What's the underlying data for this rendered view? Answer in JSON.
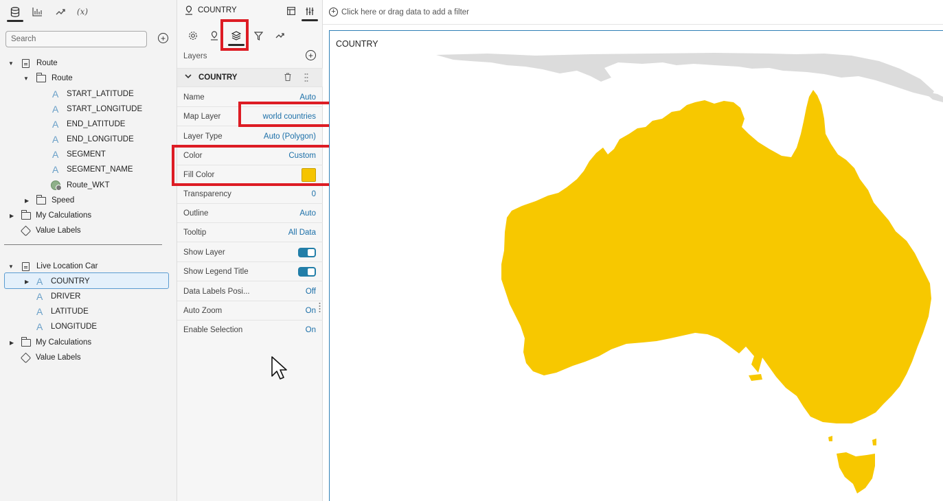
{
  "left_panel": {
    "tabs": [
      {
        "name": "data-tab",
        "icon": "database-icon"
      },
      {
        "name": "visualizations-tab",
        "icon": "bar-chart-icon"
      },
      {
        "name": "analytics-tab",
        "icon": "trend-icon"
      },
      {
        "name": "calculations-tab",
        "label": "(x)"
      }
    ],
    "search_placeholder": "Search",
    "datasets": [
      {
        "name": "Route",
        "folder": "Route",
        "columns": [
          "START_LATITUDE",
          "START_LONGITUDE",
          "END_LATITUDE",
          "END_LONGITUDE",
          "SEGMENT",
          "SEGMENT_NAME",
          "Route_WKT"
        ],
        "subfolder": "Speed",
        "calculations": "My Calculations",
        "value_labels": "Value Labels"
      },
      {
        "name": "Live Location Car",
        "columns": [
          "COUNTRY",
          "DRIVER",
          "LATITUDE",
          "LONGITUDE"
        ],
        "selected_column": "COUNTRY",
        "calculations": "My Calculations",
        "value_labels": "Value Labels"
      }
    ]
  },
  "properties": {
    "header_title": "COUNTRY",
    "layers_label": "Layers",
    "layer_name": "COUNTRY",
    "rows": [
      {
        "key": "Name",
        "value": "Auto"
      },
      {
        "key": "Map Layer",
        "value": "world countries"
      },
      {
        "key": "Layer Type",
        "value": "Auto (Polygon)"
      },
      {
        "key": "Color",
        "value": "Custom"
      },
      {
        "key": "Fill Color",
        "swatch": "#f5c400"
      },
      {
        "key": "Transparency",
        "value": "0"
      },
      {
        "key": "Outline",
        "value": "Auto"
      },
      {
        "key": "Tooltip",
        "value": "All Data"
      },
      {
        "key": "Show Layer",
        "toggle": true
      },
      {
        "key": "Show Legend Title",
        "toggle": true
      },
      {
        "key": "Data Labels Posi...",
        "value": "Off"
      },
      {
        "key": "Auto Zoom",
        "value": "On"
      },
      {
        "key": "Enable Selection",
        "value": "On"
      }
    ]
  },
  "filter_bar": {
    "text": "Click here or drag data to add a filter"
  },
  "visualization": {
    "title": "COUNTRY",
    "fill_color": "#f7c800",
    "neighbor_color": "#dcdcdc"
  },
  "colors": {
    "accent": "#1b6fa8",
    "highlight_box": "#dd1c24",
    "toggle_on": "#227ea8"
  }
}
